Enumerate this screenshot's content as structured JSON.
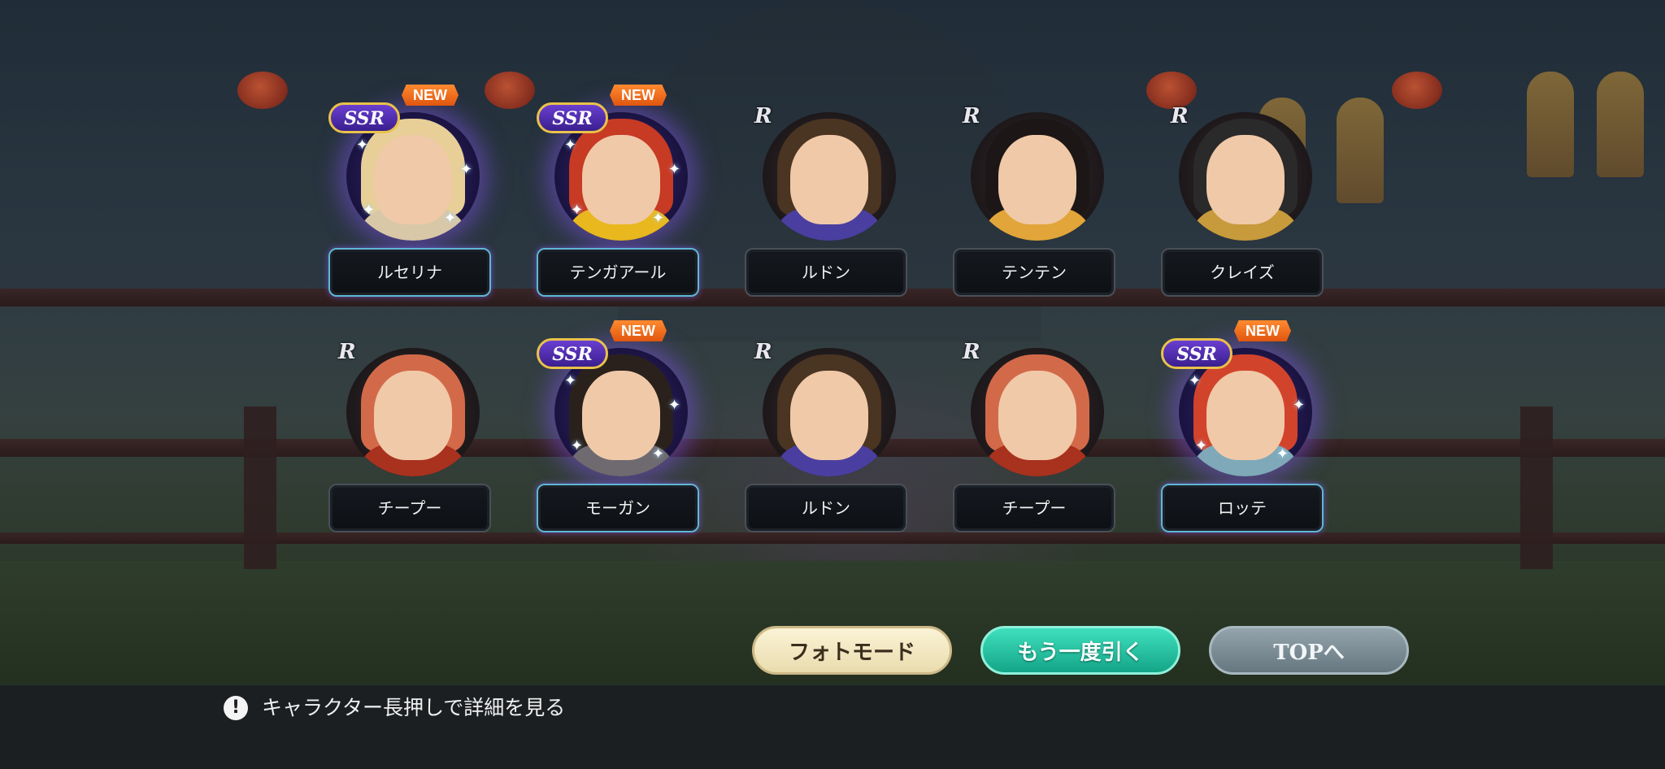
{
  "characters": [
    {
      "name": "ルセリナ",
      "rarity": "SSR",
      "is_new": true,
      "new_label": "NEW",
      "hair": "#e7cf97",
      "outfit": "#d8c8a8"
    },
    {
      "name": "テンガアール",
      "rarity": "SSR",
      "is_new": true,
      "new_label": "NEW",
      "hair": "#c73a24",
      "outfit": "#e8b81e"
    },
    {
      "name": "ルドン",
      "rarity": "R",
      "is_new": false,
      "hair": "#4a3422",
      "outfit": "#4a3fa0"
    },
    {
      "name": "テンテン",
      "rarity": "R",
      "is_new": false,
      "hair": "#1d1616",
      "outfit": "#e1a53a"
    },
    {
      "name": "クレイズ",
      "rarity": "R",
      "is_new": false,
      "hair": "#2a2a2a",
      "outfit": "#c79a3c"
    },
    {
      "name": "チープー",
      "rarity": "R",
      "is_new": false,
      "hair": "#d26a4a",
      "outfit": "#a8321e"
    },
    {
      "name": "モーガン",
      "rarity": "SSR",
      "is_new": true,
      "new_label": "NEW",
      "hair": "#2a211c",
      "outfit": "#6e6a70"
    },
    {
      "name": "ルドン",
      "rarity": "R",
      "is_new": false,
      "hair": "#4a3422",
      "outfit": "#4a3fa0"
    },
    {
      "name": "チープー",
      "rarity": "R",
      "is_new": false,
      "hair": "#d26a4a",
      "outfit": "#a8321e"
    },
    {
      "name": "ロッテ",
      "rarity": "SSR",
      "is_new": true,
      "new_label": "NEW",
      "hair": "#d2432c",
      "outfit": "#7fa9b8"
    }
  ],
  "buttons": {
    "photo_mode": "フォトモード",
    "draw_again": "もう一度引く",
    "to_top": "TOPへ"
  },
  "hint": {
    "icon": "exclamation-icon",
    "text": "キャラクター長押しで詳細を見る"
  },
  "colors": {
    "draw_again_accent": "#1fc4a2",
    "ssr_badge": "#5a34c0",
    "new_badge": "#f06b1f"
  }
}
